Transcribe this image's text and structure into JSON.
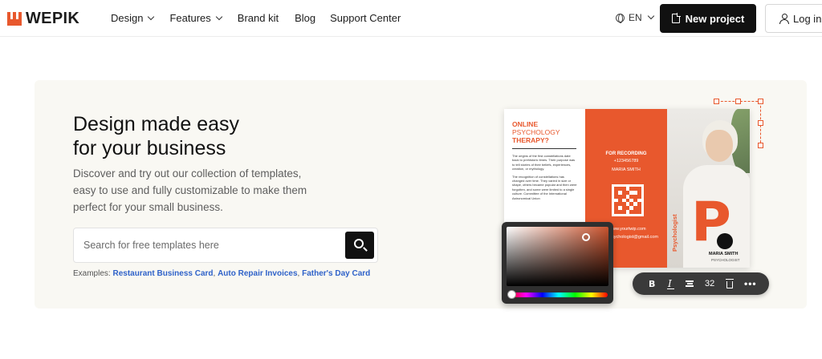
{
  "brand": {
    "name": "WEPIK",
    "accent": "#e8582d",
    "logo_icon": "crown-logo-icon"
  },
  "nav": {
    "items": [
      {
        "label": "Design",
        "dropdown": true
      },
      {
        "label": "Features",
        "dropdown": true
      },
      {
        "label": "Brand kit",
        "dropdown": false
      },
      {
        "label": "Blog",
        "dropdown": false
      },
      {
        "label": "Support Center",
        "dropdown": false
      }
    ]
  },
  "header": {
    "language": "EN",
    "new_project_label": "New project",
    "login_label": "Log in"
  },
  "hero": {
    "title_line1": "Design made easy",
    "title_line2": "for your business",
    "subtitle": "Discover and try out our collection of templates, easy to use and fully customizable to make them perfect for your small business.",
    "search_placeholder": "Search for free templates here",
    "examples_label": "Examples:",
    "examples": [
      "Restaurant Business Card",
      "Auto Repair Invoices",
      "Father's Day Card"
    ]
  },
  "brochure": {
    "heading_bold": "ONLINE",
    "heading_light": "PSYCHOLOGY",
    "heading_bold2": "THERAPY?",
    "body1": "The origins of the first constellations date back to prehistoric times. Their purpose was to tell stories of their beliefs, experiences, creation, or mythology.",
    "body2": "The recognition of constellations has changed over time. They varied in size or shape, others became popular and then were forgotten, and some were limited to a single culture. Committee of the International Astronomical Union",
    "recording": "FOR RECORDING",
    "phone": "+123456789",
    "middle_name": "MARIA SMITH",
    "website": "www.yourtwip.com",
    "email": "psychologist@gmail.com",
    "big_letter": "P",
    "vertical_label": "Psychologist",
    "person_name": "MARIA SMITH",
    "person_role": "PSYCHOLOGIST"
  },
  "toolbar": {
    "bold": "B",
    "italic": "I",
    "font_size": "32",
    "more": "•••"
  }
}
